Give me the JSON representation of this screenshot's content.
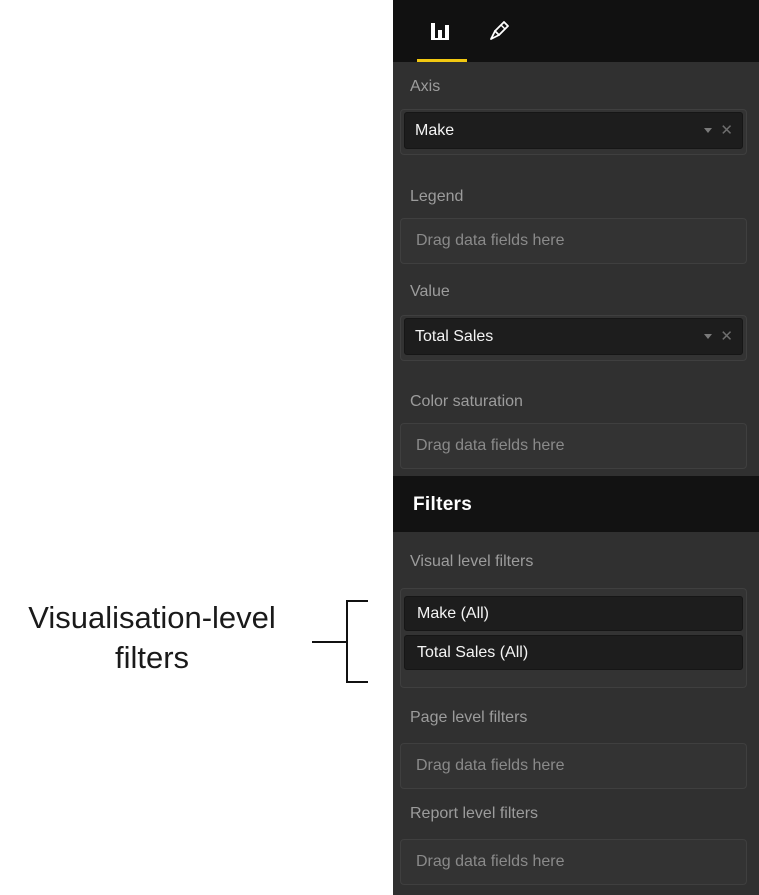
{
  "annotation": {
    "line1": "Visualisation-level",
    "line2": "filters"
  },
  "pane": {
    "tabs": [
      {
        "name": "Fields",
        "icon": "bar-chart-icon",
        "active": true
      },
      {
        "name": "Format",
        "icon": "paint-roller-icon",
        "active": false
      }
    ],
    "accent_color": "#f2c811",
    "axis": {
      "label": "Axis",
      "value": "Make"
    },
    "legend": {
      "label": "Legend",
      "placeholder": "Drag data fields here"
    },
    "value": {
      "label": "Value",
      "value": "Total Sales"
    },
    "color_saturation": {
      "label": "Color saturation",
      "placeholder": "Drag data fields here"
    }
  },
  "filters": {
    "title": "Filters",
    "visual_level": {
      "label": "Visual level filters",
      "items": [
        "Make (All)",
        "Total Sales (All)"
      ]
    },
    "page_level": {
      "label": "Page level filters",
      "placeholder": "Drag data fields here"
    },
    "report_level": {
      "label": "Report level filters",
      "placeholder": "Drag data fields here"
    }
  }
}
